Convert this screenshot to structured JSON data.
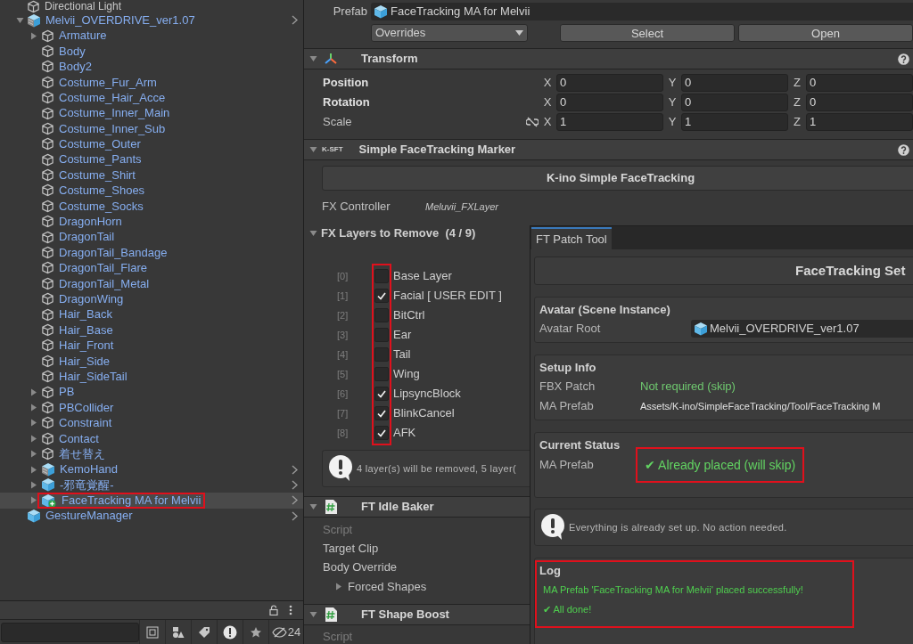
{
  "hierarchy": {
    "items": [
      {
        "name": "Directional Light",
        "kind": "object",
        "has_children": false,
        "selected": false,
        "outlined": false,
        "chevron": false
      },
      {
        "name": "Melvii_OVERDRIVE_ver1.07",
        "kind": "prefab_variant",
        "has_children": true,
        "expanded": true,
        "selected": false,
        "outlined": false,
        "chevron": true,
        "children": [
          {
            "name": "Armature",
            "kind": "object",
            "has_children": true,
            "expanded": false,
            "selected": false,
            "outlined": false,
            "chevron": false
          },
          {
            "name": "Body",
            "kind": "object",
            "has_children": false,
            "selected": false,
            "outlined": false,
            "chevron": false
          },
          {
            "name": "Body2",
            "kind": "object",
            "has_children": false,
            "selected": false,
            "outlined": false,
            "chevron": false
          },
          {
            "name": "Costume_Fur_Arm",
            "kind": "object",
            "has_children": false,
            "selected": false,
            "outlined": false,
            "chevron": false
          },
          {
            "name": "Costume_Hair_Acce",
            "kind": "object",
            "has_children": false,
            "selected": false,
            "outlined": false,
            "chevron": false
          },
          {
            "name": "Costume_Inner_Main",
            "kind": "object",
            "has_children": false,
            "selected": false,
            "outlined": false,
            "chevron": false
          },
          {
            "name": "Costume_Inner_Sub",
            "kind": "object",
            "has_children": false,
            "selected": false,
            "outlined": false,
            "chevron": false
          },
          {
            "name": "Costume_Outer",
            "kind": "object",
            "has_children": false,
            "selected": false,
            "outlined": false,
            "chevron": false
          },
          {
            "name": "Costume_Pants",
            "kind": "object",
            "has_children": false,
            "selected": false,
            "outlined": false,
            "chevron": false
          },
          {
            "name": "Costume_Shirt",
            "kind": "object",
            "has_children": false,
            "selected": false,
            "outlined": false,
            "chevron": false
          },
          {
            "name": "Costume_Shoes",
            "kind": "object",
            "has_children": false,
            "selected": false,
            "outlined": false,
            "chevron": false
          },
          {
            "name": "Costume_Socks",
            "kind": "object",
            "has_children": false,
            "selected": false,
            "outlined": false,
            "chevron": false
          },
          {
            "name": "DragonHorn",
            "kind": "object",
            "has_children": false,
            "selected": false,
            "outlined": false,
            "chevron": false
          },
          {
            "name": "DragonTail",
            "kind": "object",
            "has_children": false,
            "selected": false,
            "outlined": false,
            "chevron": false
          },
          {
            "name": "DragonTail_Bandage",
            "kind": "object",
            "has_children": false,
            "selected": false,
            "outlined": false,
            "chevron": false
          },
          {
            "name": "DragonTail_Flare",
            "kind": "object",
            "has_children": false,
            "selected": false,
            "outlined": false,
            "chevron": false
          },
          {
            "name": "DragonTail_Metal",
            "kind": "object",
            "has_children": false,
            "selected": false,
            "outlined": false,
            "chevron": false
          },
          {
            "name": "DragonWing",
            "kind": "object",
            "has_children": false,
            "selected": false,
            "outlined": false,
            "chevron": false
          },
          {
            "name": "Hair_Back",
            "kind": "object",
            "has_children": false,
            "selected": false,
            "outlined": false,
            "chevron": false
          },
          {
            "name": "Hair_Base",
            "kind": "object",
            "has_children": false,
            "selected": false,
            "outlined": false,
            "chevron": false
          },
          {
            "name": "Hair_Front",
            "kind": "object",
            "has_children": false,
            "selected": false,
            "outlined": false,
            "chevron": false
          },
          {
            "name": "Hair_Side",
            "kind": "object",
            "has_children": false,
            "selected": false,
            "outlined": false,
            "chevron": false
          },
          {
            "name": "Hair_SideTail",
            "kind": "object",
            "has_children": false,
            "selected": false,
            "outlined": false,
            "chevron": false
          },
          {
            "name": "PB",
            "kind": "object",
            "has_children": true,
            "expanded": false,
            "selected": false,
            "outlined": false,
            "chevron": false
          },
          {
            "name": "PBCollider",
            "kind": "object",
            "has_children": true,
            "expanded": false,
            "selected": false,
            "outlined": false,
            "chevron": false
          },
          {
            "name": "Constraint",
            "kind": "object",
            "has_children": true,
            "expanded": false,
            "selected": false,
            "outlined": false,
            "chevron": false
          },
          {
            "name": "Contact",
            "kind": "object",
            "has_children": true,
            "expanded": false,
            "selected": false,
            "outlined": false,
            "chevron": false
          },
          {
            "name": "着せ替え",
            "kind": "object",
            "has_children": true,
            "expanded": false,
            "selected": false,
            "outlined": false,
            "chevron": false
          },
          {
            "name": "KemoHand",
            "kind": "prefab_variant",
            "has_children": true,
            "expanded": false,
            "selected": false,
            "outlined": false,
            "chevron": true
          },
          {
            "name": "-邪竜覚醒-",
            "kind": "prefab",
            "has_children": true,
            "expanded": false,
            "selected": false,
            "outlined": false,
            "chevron": true
          },
          {
            "name": "FaceTracking MA for Melvii",
            "kind": "prefab_added",
            "has_children": true,
            "expanded": false,
            "selected": true,
            "outlined": true,
            "chevron": true
          }
        ]
      },
      {
        "name": "GestureManager",
        "kind": "prefab",
        "has_children": false,
        "selected": false,
        "outlined": false,
        "chevron": true
      }
    ],
    "hidden_count": "24"
  },
  "inspector": {
    "prefab": {
      "label": "Prefab",
      "value": "FaceTracking MA for Melvii",
      "overrides": "Overrides",
      "buttons": [
        "Select",
        "Open"
      ]
    },
    "transform": {
      "title": "Transform",
      "expanded": true,
      "rows": [
        {
          "label": "Position",
          "overridden": true,
          "constrain": false,
          "values": [
            {
              "axis": "X",
              "value": "0"
            },
            {
              "axis": "Y",
              "value": "0"
            },
            {
              "axis": "Z",
              "value": "0"
            }
          ]
        },
        {
          "label": "Rotation",
          "overridden": true,
          "constrain": false,
          "values": [
            {
              "axis": "X",
              "value": "0"
            },
            {
              "axis": "Y",
              "value": "0"
            },
            {
              "axis": "Z",
              "value": "0"
            }
          ]
        },
        {
          "label": "Scale",
          "overridden": false,
          "constrain": true,
          "values": [
            {
              "axis": "X",
              "value": "1"
            },
            {
              "axis": "Y",
              "value": "1"
            },
            {
              "axis": "Z",
              "value": "1"
            }
          ]
        }
      ]
    },
    "marker": {
      "title": "Simple FaceTracking Marker",
      "logo": "K-SFT",
      "expanded": true,
      "button": "K-ino Simple FaceTracking",
      "fx_controller": {
        "label": "FX Controller",
        "value": "Meluvii_FXLayer"
      },
      "layers_title": "FX Layers to Remove  (4 / 9)",
      "layers_expanded": true,
      "layers_outlined": true,
      "layers": [
        {
          "index": "[0]",
          "name": "Base Layer",
          "checked": false
        },
        {
          "index": "[1]",
          "name": "Facial [ USER EDIT ]",
          "checked": true
        },
        {
          "index": "[2]",
          "name": "BitCtrl",
          "checked": false
        },
        {
          "index": "[3]",
          "name": "Ear",
          "checked": false
        },
        {
          "index": "[4]",
          "name": "Tail",
          "checked": false
        },
        {
          "index": "[5]",
          "name": "Wing",
          "checked": false
        },
        {
          "index": "[6]",
          "name": "LipsyncBlock",
          "checked": true
        },
        {
          "index": "[7]",
          "name": "BlinkCancel",
          "checked": true
        },
        {
          "index": "[8]",
          "name": "AFK",
          "checked": true
        }
      ],
      "help": "4 layer(s) will be removed, 5 layer("
    },
    "scripts": [
      {
        "title": "FT Idle Baker",
        "expanded": true,
        "fields": [
          {
            "label": "Script",
            "kind": "property",
            "disabled": true
          },
          {
            "label": "Target Clip",
            "kind": "property",
            "disabled": false
          },
          {
            "label": "Body Override",
            "kind": "property",
            "disabled": false
          },
          {
            "label": "Forced Shapes",
            "kind": "foldout",
            "disabled": false
          }
        ]
      },
      {
        "title": "FT Shape Boost",
        "expanded": true,
        "fields": [
          {
            "label": "Script",
            "kind": "property",
            "disabled": true
          }
        ]
      }
    ]
  },
  "patch_tool": {
    "tab": "FT Patch Tool",
    "title": "FaceTracking Set",
    "sections": [
      {
        "heading": "Avatar (Scene Instance)",
        "rows": [
          {
            "label": "Avatar Root",
            "value": "Melvii_OVERDRIVE_ver1.07",
            "kind": "object",
            "outlined": false
          }
        ]
      },
      {
        "heading": "Setup Info",
        "rows": [
          {
            "label": "FBX Patch",
            "value": "Not required (skip)",
            "kind": "ok",
            "outlined": false
          },
          {
            "label": "MA Prefab",
            "value": "Assets/K-ino/SimpleFaceTracking/Tool/FaceTracking M",
            "kind": "path",
            "outlined": false
          }
        ]
      },
      {
        "heading": "Current Status",
        "rows": [
          {
            "label": "MA Prefab",
            "value": "✔ Already placed (will skip)",
            "kind": "status",
            "outlined": true
          }
        ]
      }
    ],
    "help": "Everything is already set up. No action needed.",
    "log": {
      "heading": "Log",
      "outlined": true,
      "lines": [
        "MA Prefab 'FaceTracking MA for Melvii' placed successfully!",
        "✔ All done!"
      ]
    }
  }
}
